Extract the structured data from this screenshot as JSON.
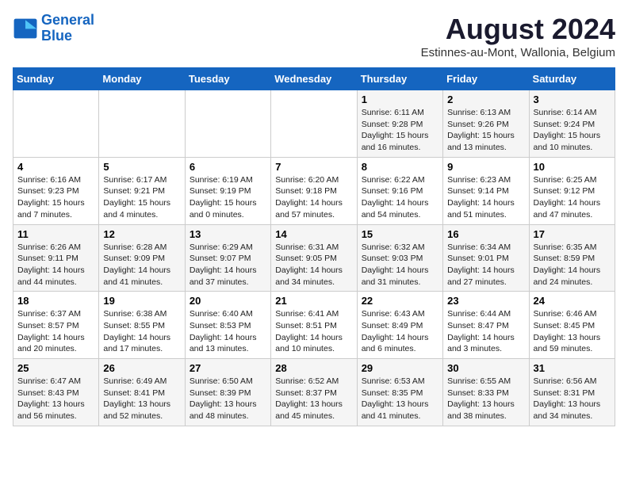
{
  "logo": {
    "line1": "General",
    "line2": "Blue"
  },
  "title": "August 2024",
  "subtitle": "Estinnes-au-Mont, Wallonia, Belgium",
  "days_of_week": [
    "Sunday",
    "Monday",
    "Tuesday",
    "Wednesday",
    "Thursday",
    "Friday",
    "Saturday"
  ],
  "weeks": [
    [
      {
        "day": "",
        "info": ""
      },
      {
        "day": "",
        "info": ""
      },
      {
        "day": "",
        "info": ""
      },
      {
        "day": "",
        "info": ""
      },
      {
        "day": "1",
        "info": "Sunrise: 6:11 AM\nSunset: 9:28 PM\nDaylight: 15 hours and 16 minutes."
      },
      {
        "day": "2",
        "info": "Sunrise: 6:13 AM\nSunset: 9:26 PM\nDaylight: 15 hours and 13 minutes."
      },
      {
        "day": "3",
        "info": "Sunrise: 6:14 AM\nSunset: 9:24 PM\nDaylight: 15 hours and 10 minutes."
      }
    ],
    [
      {
        "day": "4",
        "info": "Sunrise: 6:16 AM\nSunset: 9:23 PM\nDaylight: 15 hours and 7 minutes."
      },
      {
        "day": "5",
        "info": "Sunrise: 6:17 AM\nSunset: 9:21 PM\nDaylight: 15 hours and 4 minutes."
      },
      {
        "day": "6",
        "info": "Sunrise: 6:19 AM\nSunset: 9:19 PM\nDaylight: 15 hours and 0 minutes."
      },
      {
        "day": "7",
        "info": "Sunrise: 6:20 AM\nSunset: 9:18 PM\nDaylight: 14 hours and 57 minutes."
      },
      {
        "day": "8",
        "info": "Sunrise: 6:22 AM\nSunset: 9:16 PM\nDaylight: 14 hours and 54 minutes."
      },
      {
        "day": "9",
        "info": "Sunrise: 6:23 AM\nSunset: 9:14 PM\nDaylight: 14 hours and 51 minutes."
      },
      {
        "day": "10",
        "info": "Sunrise: 6:25 AM\nSunset: 9:12 PM\nDaylight: 14 hours and 47 minutes."
      }
    ],
    [
      {
        "day": "11",
        "info": "Sunrise: 6:26 AM\nSunset: 9:11 PM\nDaylight: 14 hours and 44 minutes."
      },
      {
        "day": "12",
        "info": "Sunrise: 6:28 AM\nSunset: 9:09 PM\nDaylight: 14 hours and 41 minutes."
      },
      {
        "day": "13",
        "info": "Sunrise: 6:29 AM\nSunset: 9:07 PM\nDaylight: 14 hours and 37 minutes."
      },
      {
        "day": "14",
        "info": "Sunrise: 6:31 AM\nSunset: 9:05 PM\nDaylight: 14 hours and 34 minutes."
      },
      {
        "day": "15",
        "info": "Sunrise: 6:32 AM\nSunset: 9:03 PM\nDaylight: 14 hours and 31 minutes."
      },
      {
        "day": "16",
        "info": "Sunrise: 6:34 AM\nSunset: 9:01 PM\nDaylight: 14 hours and 27 minutes."
      },
      {
        "day": "17",
        "info": "Sunrise: 6:35 AM\nSunset: 8:59 PM\nDaylight: 14 hours and 24 minutes."
      }
    ],
    [
      {
        "day": "18",
        "info": "Sunrise: 6:37 AM\nSunset: 8:57 PM\nDaylight: 14 hours and 20 minutes."
      },
      {
        "day": "19",
        "info": "Sunrise: 6:38 AM\nSunset: 8:55 PM\nDaylight: 14 hours and 17 minutes."
      },
      {
        "day": "20",
        "info": "Sunrise: 6:40 AM\nSunset: 8:53 PM\nDaylight: 14 hours and 13 minutes."
      },
      {
        "day": "21",
        "info": "Sunrise: 6:41 AM\nSunset: 8:51 PM\nDaylight: 14 hours and 10 minutes."
      },
      {
        "day": "22",
        "info": "Sunrise: 6:43 AM\nSunset: 8:49 PM\nDaylight: 14 hours and 6 minutes."
      },
      {
        "day": "23",
        "info": "Sunrise: 6:44 AM\nSunset: 8:47 PM\nDaylight: 14 hours and 3 minutes."
      },
      {
        "day": "24",
        "info": "Sunrise: 6:46 AM\nSunset: 8:45 PM\nDaylight: 13 hours and 59 minutes."
      }
    ],
    [
      {
        "day": "25",
        "info": "Sunrise: 6:47 AM\nSunset: 8:43 PM\nDaylight: 13 hours and 56 minutes."
      },
      {
        "day": "26",
        "info": "Sunrise: 6:49 AM\nSunset: 8:41 PM\nDaylight: 13 hours and 52 minutes."
      },
      {
        "day": "27",
        "info": "Sunrise: 6:50 AM\nSunset: 8:39 PM\nDaylight: 13 hours and 48 minutes."
      },
      {
        "day": "28",
        "info": "Sunrise: 6:52 AM\nSunset: 8:37 PM\nDaylight: 13 hours and 45 minutes."
      },
      {
        "day": "29",
        "info": "Sunrise: 6:53 AM\nSunset: 8:35 PM\nDaylight: 13 hours and 41 minutes."
      },
      {
        "day": "30",
        "info": "Sunrise: 6:55 AM\nSunset: 8:33 PM\nDaylight: 13 hours and 38 minutes."
      },
      {
        "day": "31",
        "info": "Sunrise: 6:56 AM\nSunset: 8:31 PM\nDaylight: 13 hours and 34 minutes."
      }
    ]
  ]
}
